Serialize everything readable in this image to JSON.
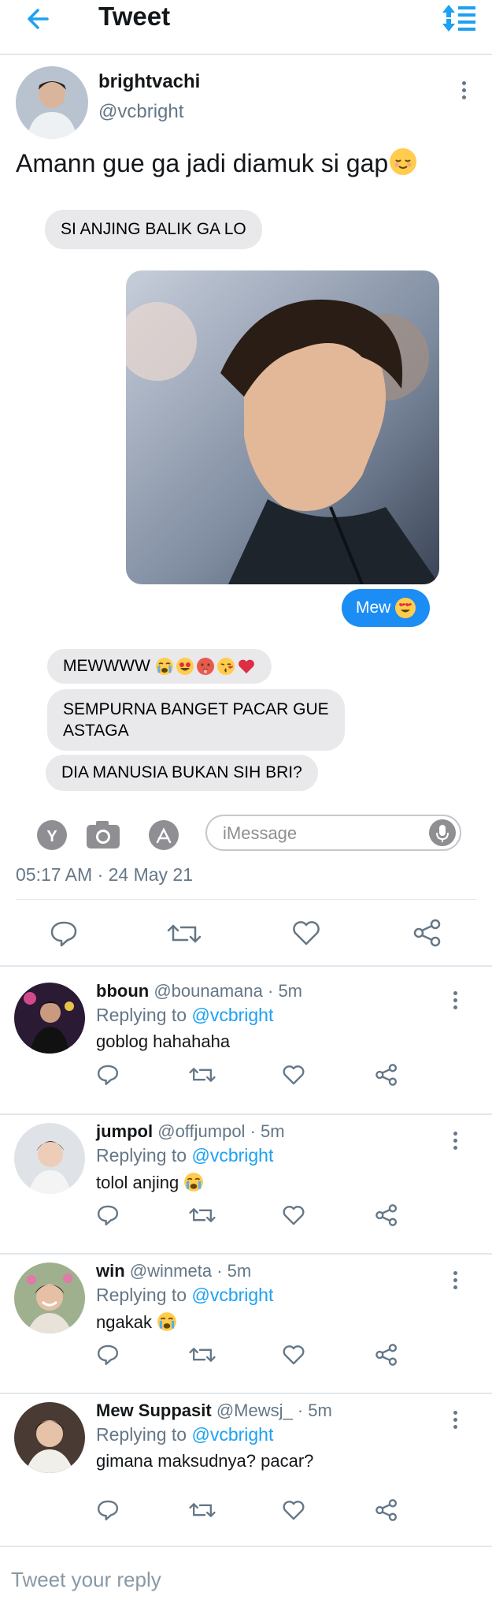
{
  "header": {
    "title": "Tweet",
    "back_icon": "arrow-left-icon",
    "sort_icon": "sort-icon",
    "accent": "#1da1f2"
  },
  "tweet": {
    "name": "brightvachi",
    "handle": "@vcbright",
    "text": "Amann gue ga jadi diamuk si gap",
    "text_emoji": "relieved-face-emoji",
    "timestamp": "05:17 AM · 24 May 21",
    "screenshot": {
      "bubble_1": "SI ANJING BALIK GA LO",
      "sent_label": "Mew",
      "sent_emoji": "heart-eyes-emoji",
      "bubble_2": "MEWWWW",
      "bubble_2_emojis": [
        "crying-face-emoji",
        "heart-eyes-emoji",
        "hot-face-emoji",
        "kissing-heart-emoji",
        "red-heart-emoji"
      ],
      "bubble_3_line1": "SEMPURNA BANGET PACAR GUE",
      "bubble_3_line2": "ASTAGA",
      "bubble_4": "DIA MANUSIA BUKAN SIH BRI?",
      "input_placeholder": "iMessage",
      "bubble_blue": "#1b8df5",
      "bubble_gray": "#e9e9eb"
    }
  },
  "replies": [
    {
      "name": "bboun",
      "handle": "@bounamana",
      "time": "· 5m",
      "replying_prefix": "Replying to",
      "replying_to": "@vcbright",
      "text": "goblog hahahaha"
    },
    {
      "name": "jumpol",
      "handle": "@offjumpol",
      "time": "· 5m",
      "replying_prefix": "Replying to",
      "replying_to": "@vcbright",
      "text": "tolol anjing"
    },
    {
      "name": "win",
      "handle": "@winmeta",
      "time": "· 5m",
      "replying_prefix": "Replying to",
      "replying_to": "@vcbright",
      "text": "ngakak"
    },
    {
      "name": "Mew Suppasit",
      "handle": "@Mewsj_",
      "time": "· 5m",
      "replying_prefix": "Replying to",
      "replying_to": "@vcbright",
      "text": "gimana maksudnya? pacar?"
    }
  ],
  "composer": {
    "placeholder": "Tweet your reply"
  }
}
